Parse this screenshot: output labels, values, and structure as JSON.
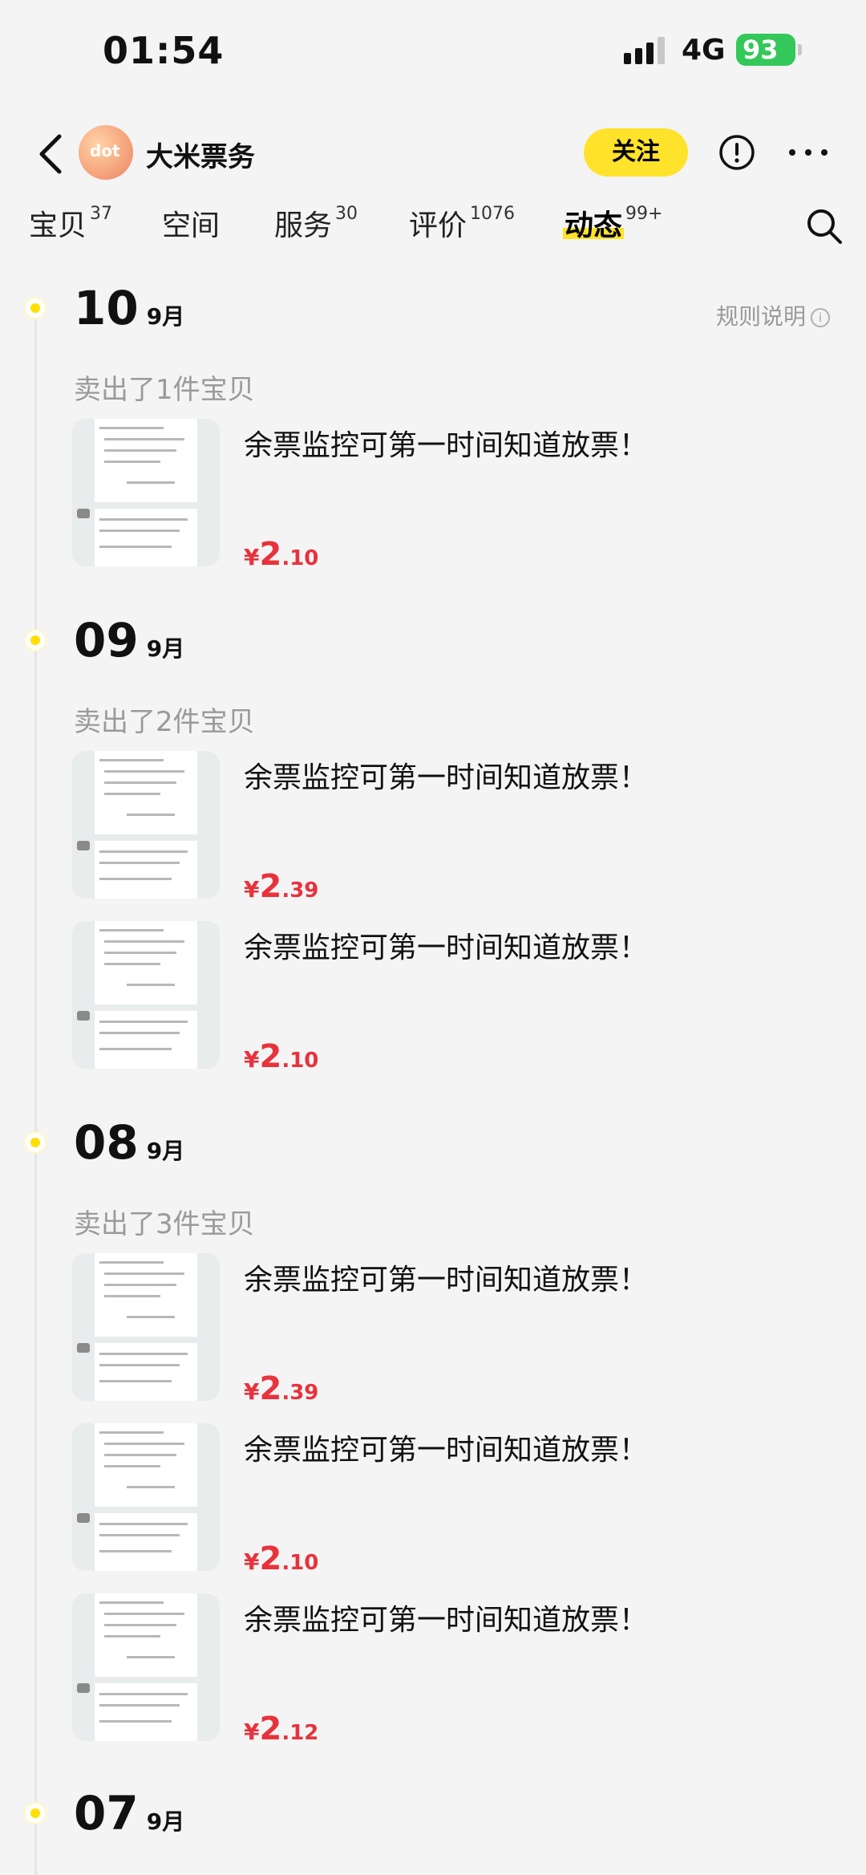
{
  "status_bar": {
    "time": "01:54",
    "network": "4G",
    "battery": "93"
  },
  "header": {
    "shop_name": "大米票务",
    "avatar_text": "dot",
    "follow_label": "关注"
  },
  "tabs": [
    {
      "label": "宝贝",
      "count": "37"
    },
    {
      "label": "空间",
      "count": ""
    },
    {
      "label": "服务",
      "count": "30"
    },
    {
      "label": "评价",
      "count": "1076"
    },
    {
      "label": "动态",
      "count": "99+",
      "active": true
    }
  ],
  "rules_label": "规则说明",
  "groups": [
    {
      "day": "10",
      "month": "9月",
      "sold": "卖出了1件宝贝",
      "items": [
        {
          "title": "余票监控可第一时间知道放票！",
          "yen": "¥",
          "int": "2",
          "dec": ".10"
        }
      ]
    },
    {
      "day": "09",
      "month": "9月",
      "sold": "卖出了2件宝贝",
      "items": [
        {
          "title": "余票监控可第一时间知道放票！",
          "yen": "¥",
          "int": "2",
          "dec": ".39"
        },
        {
          "title": "余票监控可第一时间知道放票！",
          "yen": "¥",
          "int": "2",
          "dec": ".10"
        }
      ]
    },
    {
      "day": "08",
      "month": "9月",
      "sold": "卖出了3件宝贝",
      "items": [
        {
          "title": "余票监控可第一时间知道放票！",
          "yen": "¥",
          "int": "2",
          "dec": ".39"
        },
        {
          "title": "余票监控可第一时间知道放票！",
          "yen": "¥",
          "int": "2",
          "dec": ".10"
        },
        {
          "title": "余票监控可第一时间知道放票！",
          "yen": "¥",
          "int": "2",
          "dec": ".12"
        }
      ]
    },
    {
      "day": "07",
      "month": "9月"
    }
  ],
  "colors": {
    "accent": "#ffe22a",
    "price": "#e8323c",
    "battery": "#34c759"
  }
}
